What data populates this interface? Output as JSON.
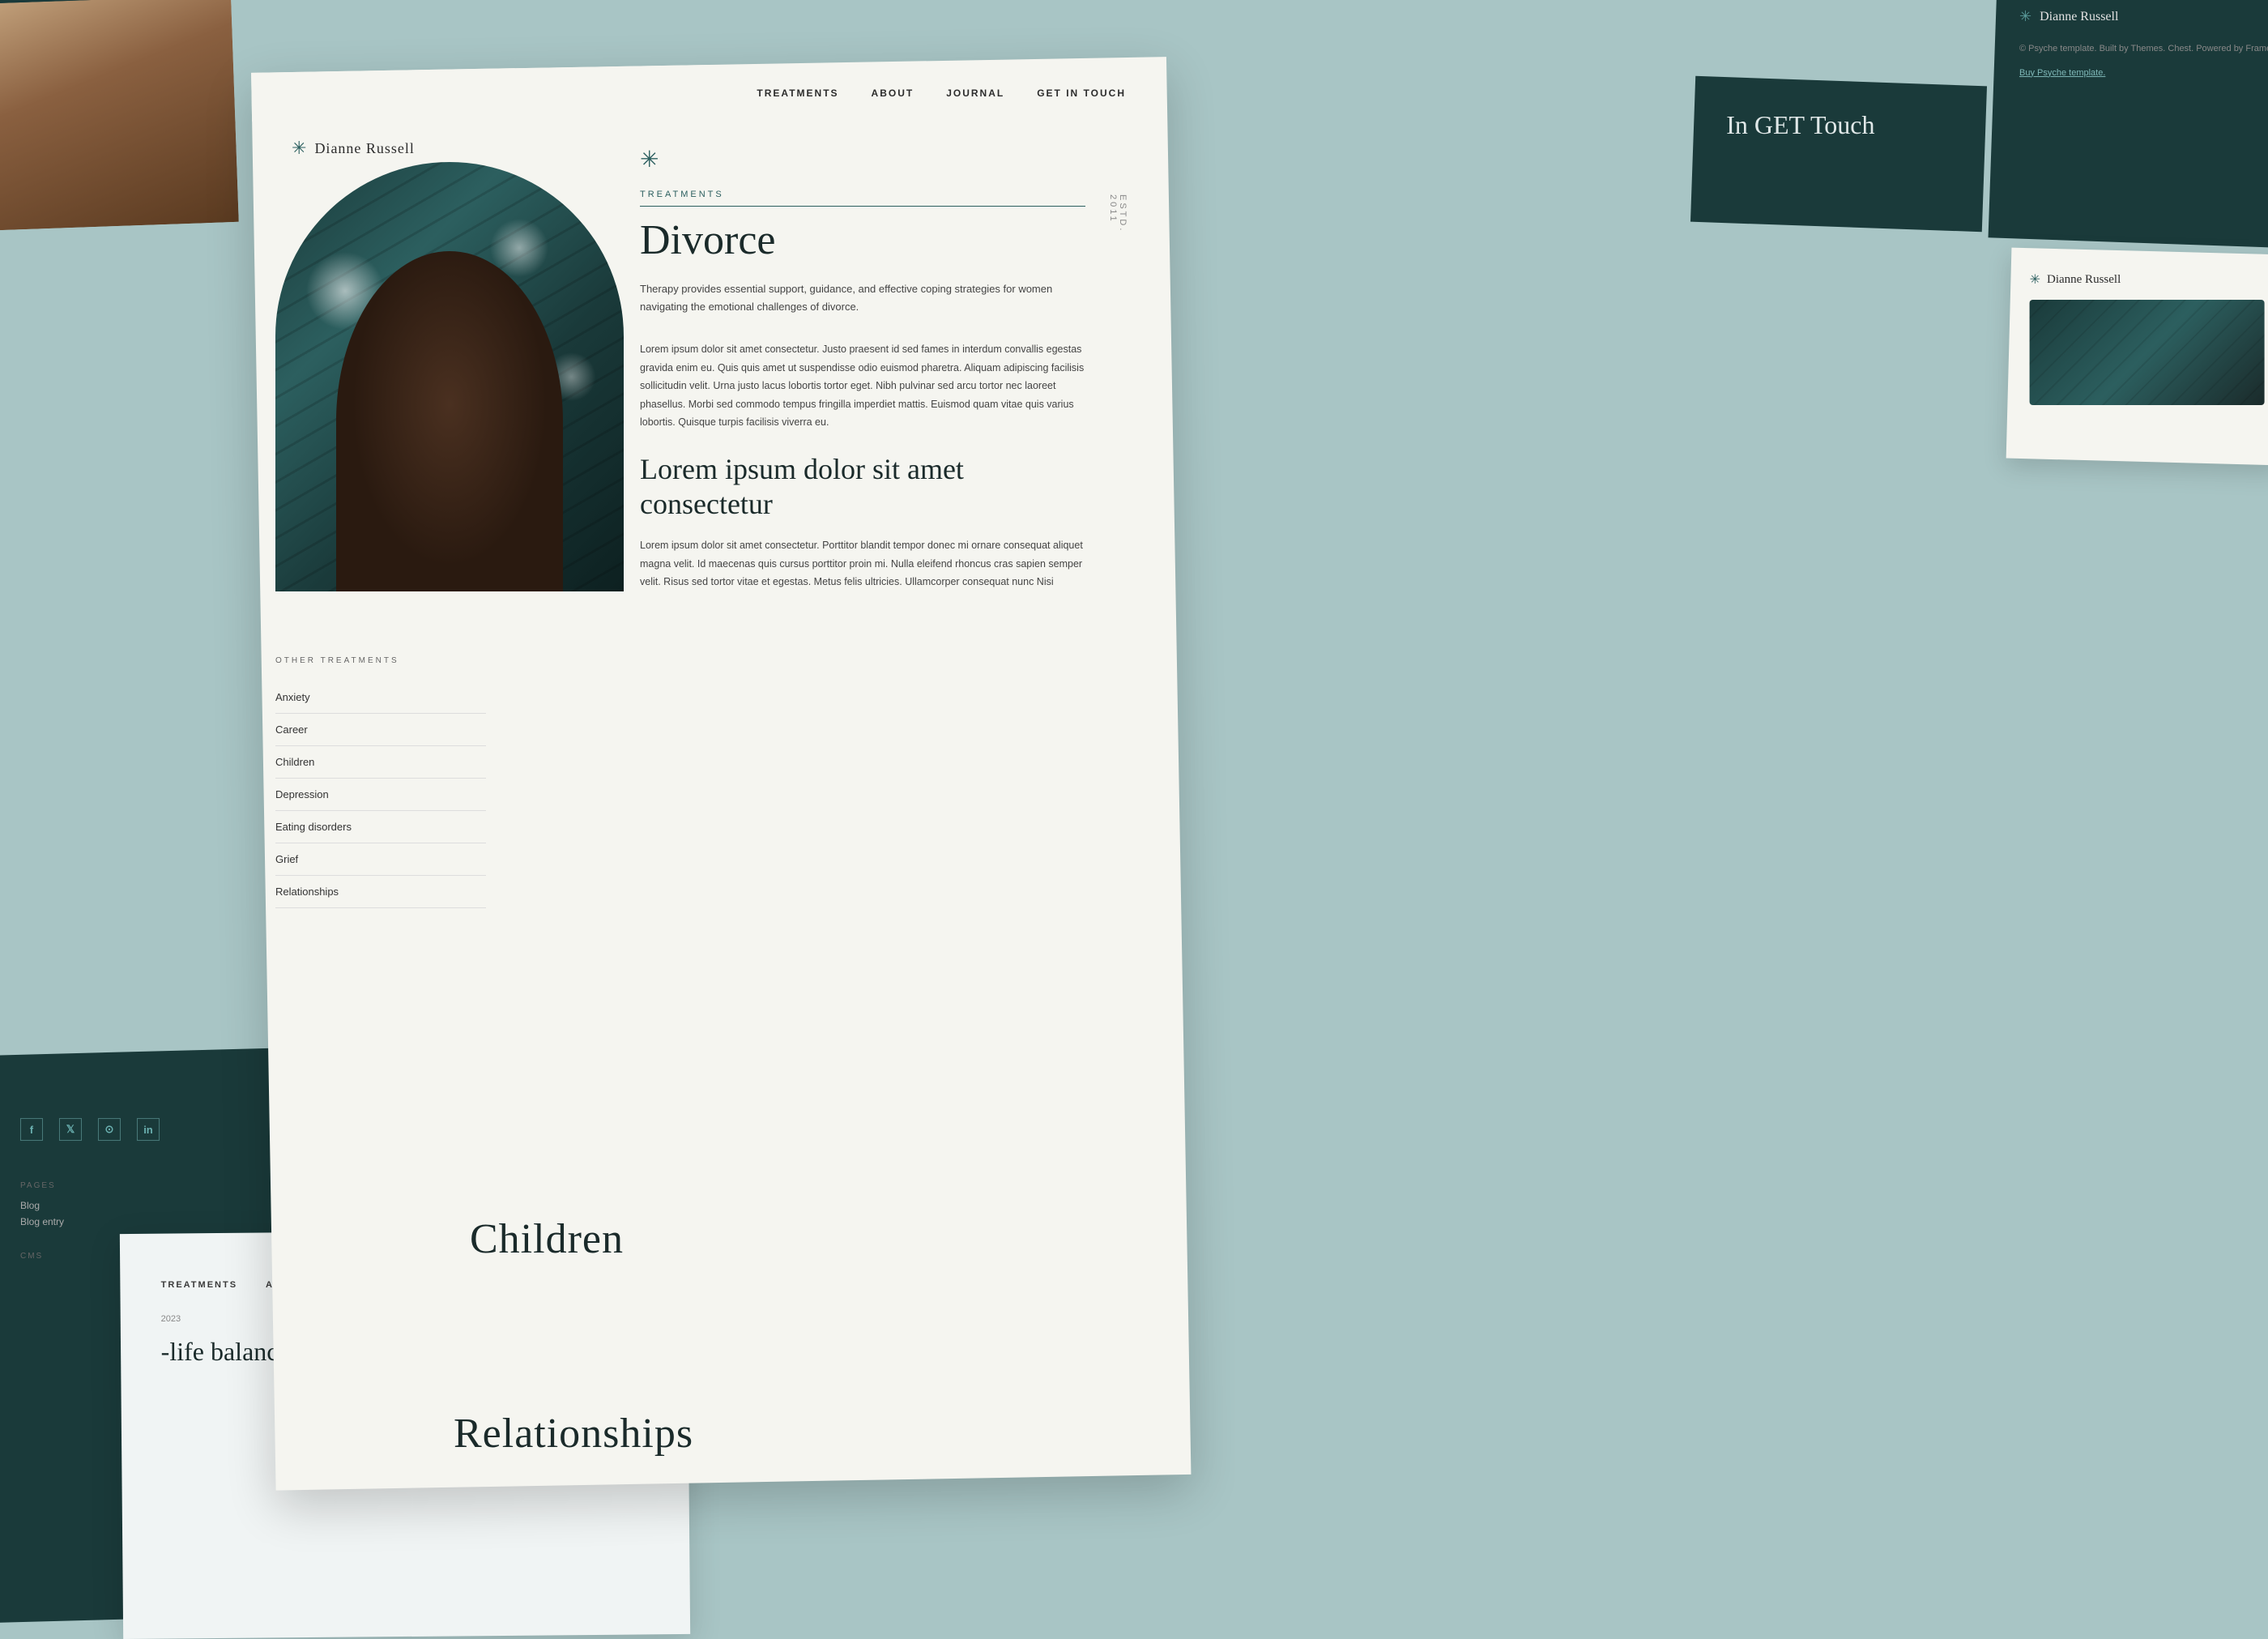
{
  "site": {
    "name": "Dianne Russell",
    "estd": "ESTD. 2011",
    "logo_icon": "✳",
    "tagline": "© Psyche template. Built by Themes. Chest. Powered by Framer.",
    "buy_link": "Buy Psyche template."
  },
  "nav": {
    "items": [
      {
        "label": "TREATMENTS"
      },
      {
        "label": "ABOUT"
      },
      {
        "label": "JOURNAL"
      },
      {
        "label": "GET IN TOUCH"
      }
    ]
  },
  "treatments": {
    "section_label": "TREATMENTS",
    "title": "Divorce",
    "subtitle": "Therapy provides essential support, guidance, and effective coping strategies for women navigating the emotional challenges of divorce.",
    "body1": "Lorem ipsum dolor sit amet consectetur. Justo praesent id sed fames in interdum convallis egestas gravida enim eu. Quis quis amet ut suspendisse odio euismod pharetra. Aliquam adipiscing facilisis sollicitudin velit. Urna justo lacus lobortis tortor eget. Nibh pulvinar sed arcu tortor nec laoreet phasellus. Morbi sed commodo tempus fringilla imperdiet mattis. Euismod quam vitae quis varius lobortis. Quisque turpis facilisis viverra eu.",
    "heading2": "Lorem ipsum dolor sit amet consectetur",
    "body2": "Lorem ipsum dolor sit amet consectetur. Porttitor blandit tempor donec mi ornare consequat aliquet magna velit. Id maecenas quis cursus porttitor proin mi. Nulla eleifend rhoncus cras sapien semper velit. Risus sed tortor vitae et egestas. Metus felis ultricies. Ullamcorper consequat nunc Nisi",
    "other_treatments_label": "OTHER TREATMENTS",
    "treatments_list": [
      "Anxiety",
      "Career",
      "Children",
      "Depression",
      "Eating disorders",
      "Grief",
      "Relationships"
    ]
  },
  "right_panel": {
    "logo_icon": "✳",
    "name": "Dianne Russell",
    "tagline": "© Psyche template. Built by Themes. Chest. Powered by Framer.",
    "buy_link": "Buy Psyche template."
  },
  "right_lower_panel": {
    "logo_icon": "✳",
    "name": "Dianne Russell"
  },
  "top_left_panel": {
    "link1": "Buy Psyche template.",
    "nav_items": [
      "About",
      "Journal",
      "Get in touch"
    ]
  },
  "bottom_left_panel": {
    "social_icons": [
      "f",
      "tw",
      "ig",
      "in"
    ],
    "pages_label": "PAGES",
    "cms_label": "CMS",
    "pages_items": [
      "Blog",
      "Blog entry"
    ]
  },
  "bottom_center_panel": {
    "nav_items": [
      "TREATMENTS",
      "ABOUT",
      "JOURNAL",
      "GET IN TOUCH"
    ],
    "date": "2023",
    "article_title": "-life balance: How to -work-life balance"
  },
  "get_in_touch": {
    "title": "In GET Touch"
  },
  "labels": {
    "children": "Children",
    "relationships": "Relationships"
  }
}
